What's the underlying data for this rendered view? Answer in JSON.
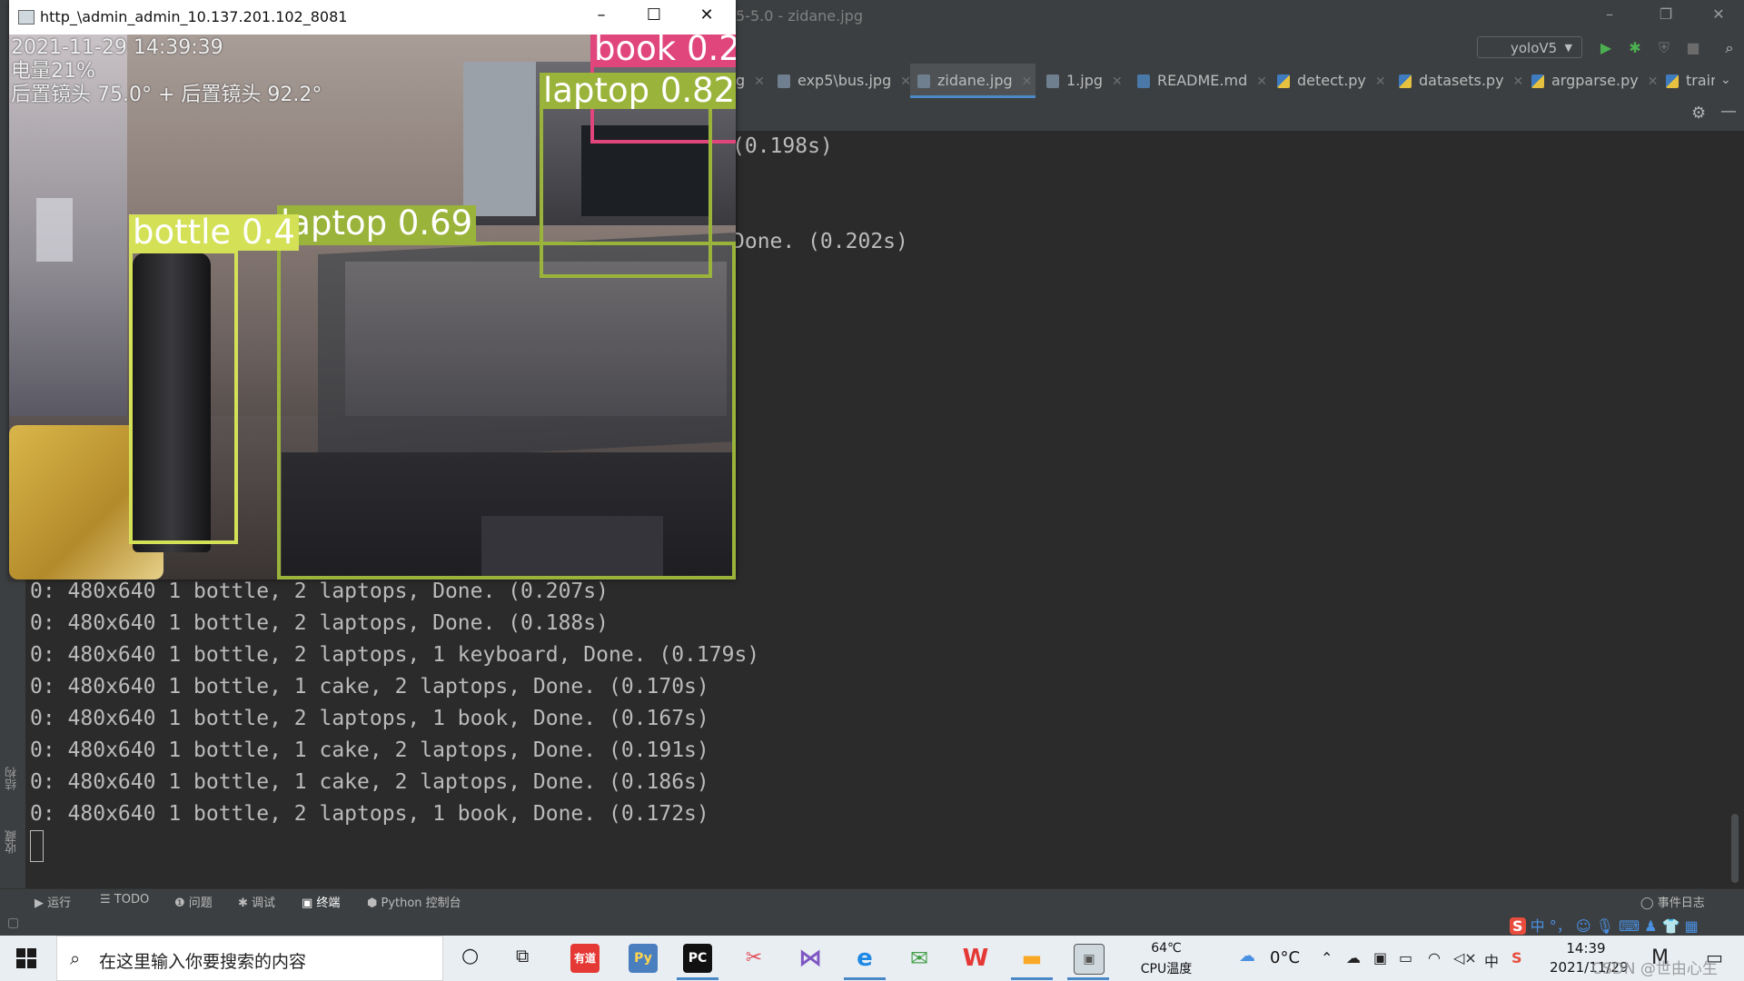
{
  "ide": {
    "title": "5-5.0 - zidane.jpg",
    "run_config": "yoloV5",
    "tabs": [
      {
        "label": "g",
        "type": "img"
      },
      {
        "label": "exp5\\bus.jpg",
        "type": "img"
      },
      {
        "label": "zidane.jpg",
        "type": "img",
        "active": true
      },
      {
        "label": "1.jpg",
        "type": "img"
      },
      {
        "label": "README.md",
        "type": "md"
      },
      {
        "label": "detect.py",
        "type": "py"
      },
      {
        "label": "datasets.py",
        "type": "py"
      },
      {
        "label": "argparse.py",
        "type": "py"
      },
      {
        "label": "train",
        "type": "py"
      }
    ]
  },
  "terminal": {
    "partial_lines": [
      "(0.198s)",
      "Done. (0.202s)"
    ],
    "lines": [
      "0: 480x640 1 bottle, 2 laptops, Done. (0.207s)",
      "0: 480x640 1 bottle, 2 laptops, Done. (0.188s)",
      "0: 480x640 1 bottle, 2 laptops, 1 keyboard, Done. (0.179s)",
      "0: 480x640 1 bottle, 1 cake, 2 laptops, Done. (0.170s)",
      "0: 480x640 1 bottle, 2 laptops, 1 book, Done. (0.167s)",
      "0: 480x640 1 bottle, 1 cake, 2 laptops, Done. (0.191s)",
      "0: 480x640 1 bottle, 1 cake, 2 laptops, Done. (0.186s)",
      "0: 480x640 1 bottle, 2 laptops, 1 book, Done. (0.172s)"
    ]
  },
  "left_strip": {
    "structure": "结构",
    "favorites": "收藏"
  },
  "bottom_tabs": {
    "run": "运行",
    "todo": "TODO",
    "problems": "问题",
    "debug": "调试",
    "terminal": "终端",
    "python_console": "Python 控制台",
    "event_log": "事件日志"
  },
  "cv_window": {
    "title": "http_\\admin_admin_10.137.201.102_8081",
    "overlay": {
      "timestamp": "2021-11-29 14:39:39",
      "battery": "电量21%",
      "camera": "后置镜头 75.0° + 后置镜头 92.2°"
    },
    "detections": [
      {
        "label": "book 0.2",
        "color": "#e0457b"
      },
      {
        "label": "laptop 0.82",
        "color": "#9ab33a"
      },
      {
        "label": "laptop 0.69",
        "color": "#9ab33a"
      },
      {
        "label": "bottle 0.4",
        "color": "#d4e157"
      }
    ]
  },
  "taskbar": {
    "search_placeholder": "在这里输入你要搜索的内容",
    "cpu_temp": "64℃",
    "cpu_label": "CPU温度",
    "weather_temp": "0°C",
    "time": "14:39",
    "date": "2021/11/29",
    "ime_label": "中",
    "watermark": "CSDN @世由心生",
    "apps": [
      "youdao",
      "python",
      "pycharm",
      "snipping",
      "visual-studio",
      "edge",
      "wechat",
      "wps",
      "explorer",
      "opencv-window"
    ]
  }
}
